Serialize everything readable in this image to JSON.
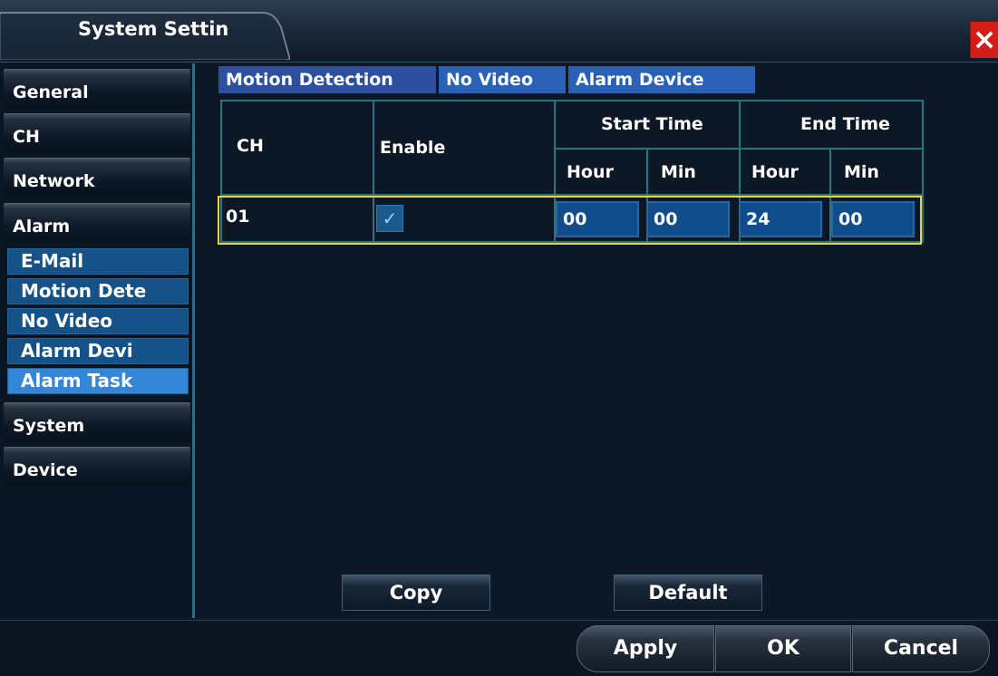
{
  "window": {
    "title": "System Settin",
    "close_glyph": "×"
  },
  "nav": {
    "items": [
      {
        "label": "General"
      },
      {
        "label": "CH"
      },
      {
        "label": "Network"
      },
      {
        "label": "Alarm"
      }
    ],
    "alarm_sub": [
      {
        "label": "E-Mail"
      },
      {
        "label": "Motion Dete"
      },
      {
        "label": "No Video"
      },
      {
        "label": "Alarm Devi"
      },
      {
        "label": "Alarm Task"
      }
    ],
    "items_after": [
      {
        "label": "System"
      },
      {
        "label": "Device"
      }
    ],
    "active_sub": "Alarm Task"
  },
  "tabs": [
    {
      "label": "Motion Detection"
    },
    {
      "label": "No Video"
    },
    {
      "label": "Alarm Device"
    }
  ],
  "table": {
    "headers": {
      "ch": "CH",
      "enable": "Enable",
      "start": "Start Time",
      "end": "End Time",
      "hour": "Hour",
      "min": "Min"
    },
    "row": {
      "ch": "01",
      "enabled": true,
      "check_glyph": "✓",
      "start_hour": "00",
      "start_min": "00",
      "end_hour": "24",
      "end_min": "00"
    }
  },
  "buttons": {
    "copy": "Copy",
    "default": "Default"
  },
  "footer": {
    "apply": "Apply",
    "ok": "OK",
    "cancel": "Cancel"
  },
  "colors": {
    "accent": "#2a61b4",
    "selected_row_border": "#e6d34a",
    "close": "#d41d16"
  }
}
